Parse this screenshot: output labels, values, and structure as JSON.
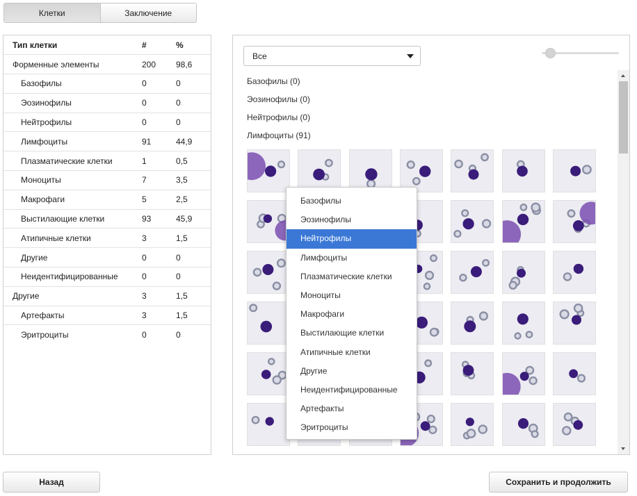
{
  "tabs": [
    {
      "label": "Клетки",
      "active": true
    },
    {
      "label": "Заключение",
      "active": false
    }
  ],
  "table": {
    "headers": {
      "type": "Тип клетки",
      "count": "#",
      "percent": "%"
    },
    "rows": [
      {
        "name": "Форменные элементы",
        "count": "200",
        "percent": "98,6",
        "level": 0
      },
      {
        "name": "Базофилы",
        "count": "0",
        "percent": "0",
        "level": 1
      },
      {
        "name": "Эозинофилы",
        "count": "0",
        "percent": "0",
        "level": 1
      },
      {
        "name": "Нейтрофилы",
        "count": "0",
        "percent": "0",
        "level": 1
      },
      {
        "name": "Лимфоциты",
        "count": "91",
        "percent": "44,9",
        "level": 1
      },
      {
        "name": "Плазматические клетки",
        "count": "1",
        "percent": "0,5",
        "level": 1
      },
      {
        "name": "Моноциты",
        "count": "7",
        "percent": "3,5",
        "level": 1
      },
      {
        "name": "Макрофаги",
        "count": "5",
        "percent": "2,5",
        "level": 1
      },
      {
        "name": "Выстилающие клетки",
        "count": "93",
        "percent": "45,9",
        "level": 1
      },
      {
        "name": "Атипичные клетки",
        "count": "3",
        "percent": "1,5",
        "level": 1
      },
      {
        "name": "Другие",
        "count": "0",
        "percent": "0",
        "level": 1
      },
      {
        "name": "Неидентифицированные",
        "count": "0",
        "percent": "0",
        "level": 1
      },
      {
        "name": "Другие",
        "count": "3",
        "percent": "1,5",
        "level": 0
      },
      {
        "name": "Артефакты",
        "count": "3",
        "percent": "1,5",
        "level": 1
      },
      {
        "name": "Эритроциты",
        "count": "0",
        "percent": "0",
        "level": 1
      }
    ]
  },
  "filter": {
    "selected": "Все"
  },
  "groups": [
    "Базофилы (0)",
    "Эозинофилы (0)",
    "Нейтрофилы (0)",
    "Лимфоциты (91)"
  ],
  "dropdown": {
    "options": [
      "Базофилы",
      "Эозинофилы",
      "Нейтрофилы",
      "Лимфоциты",
      "Плазматические клетки",
      "Моноциты",
      "Макрофаги",
      "Выстилающие клетки",
      "Атипичные клетки",
      "Другие",
      "Неидентифицированные",
      "Артефакты",
      "Эритроциты"
    ],
    "highlighted": "Нейтрофилы"
  },
  "buttons": {
    "back": "Назад",
    "save": "Сохранить и продолжить"
  },
  "colors": {
    "highlight": "#3b78d6",
    "nucleus": "#3a1c7a",
    "cytoplasm": "#7b4fb0",
    "rbc": "#8a8fa3"
  }
}
